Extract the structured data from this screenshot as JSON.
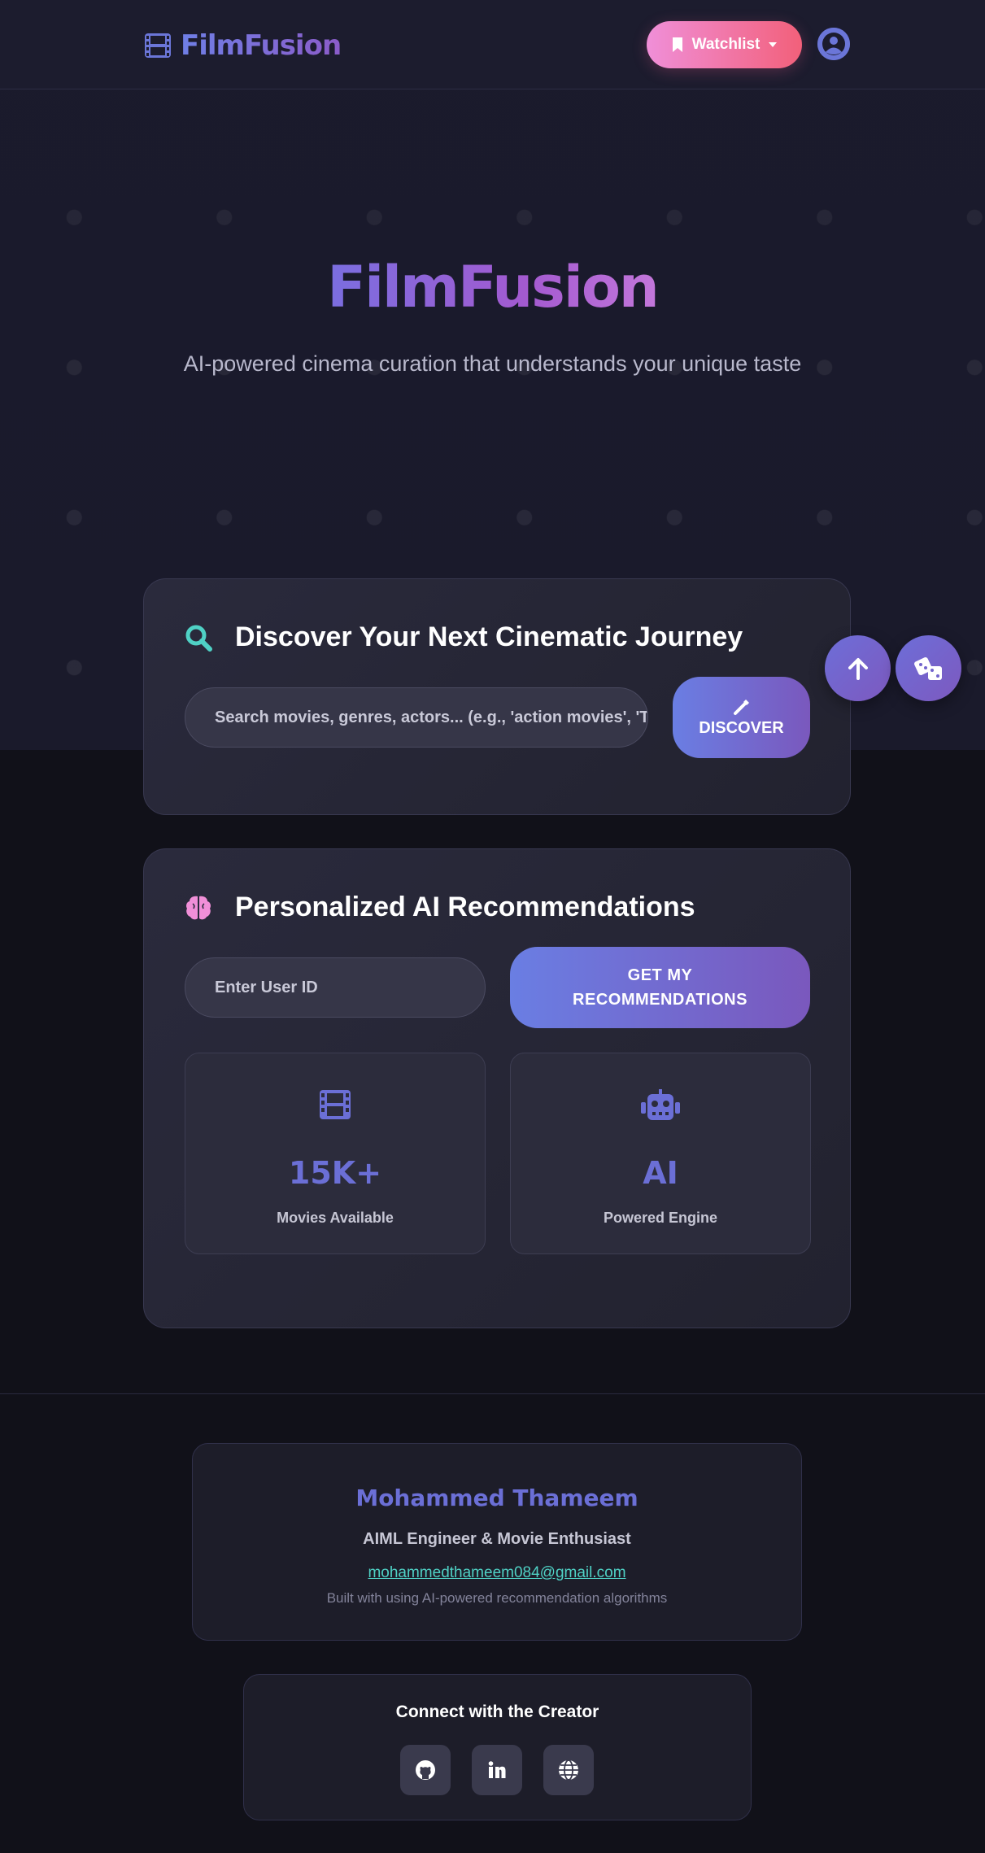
{
  "brand": {
    "name": "FilmFusion",
    "icon": "film-icon"
  },
  "nav": {
    "watchlist_label": "Watchlist",
    "watchlist_icon": "bookmark-icon",
    "dropdown_icon": "caret-down-icon",
    "user_icon": "user-circle-icon"
  },
  "hero": {
    "title": "FilmFusion",
    "subtitle": "AI-powered cinema curation that understands your unique taste"
  },
  "search": {
    "title": "Discover Your Next Cinematic Journey",
    "icon": "search-icon",
    "placeholder": "Search movies, genres, actors... (e.g., 'action movies', 'T",
    "button_label": "DISCOVER",
    "button_icon": "magic-wand-icon"
  },
  "recommendations": {
    "title": "Personalized AI Recommendations",
    "icon": "brain-icon",
    "user_id_placeholder": "Enter User ID",
    "button_line1": "GET MY",
    "button_line2": "RECOMMENDATIONS",
    "stats": [
      {
        "icon": "film-icon",
        "value": "15K+",
        "label": "Movies Available"
      },
      {
        "icon": "robot-icon",
        "value": "AI",
        "label": "Powered Engine"
      }
    ]
  },
  "floating": {
    "scroll_top_icon": "arrow-up-icon",
    "random_icon": "dice-icon"
  },
  "creator": {
    "name": "Mohammed Thameem",
    "role": "AIML Engineer & Movie Enthusiast",
    "email": "mohammedthameem084@gmail.com",
    "note": "Built with using AI-powered recommendation algorithms"
  },
  "connect": {
    "title": "Connect with the Creator",
    "links": [
      {
        "icon": "github-icon"
      },
      {
        "icon": "linkedin-icon"
      },
      {
        "icon": "globe-icon"
      }
    ]
  },
  "colors": {
    "accent": "#6b6fd6",
    "accent_purple": "#7a58bd",
    "teal": "#4fd1c5",
    "watchlist_start": "#f08fd8",
    "watchlist_end": "#f2607a",
    "background": "#111119"
  }
}
